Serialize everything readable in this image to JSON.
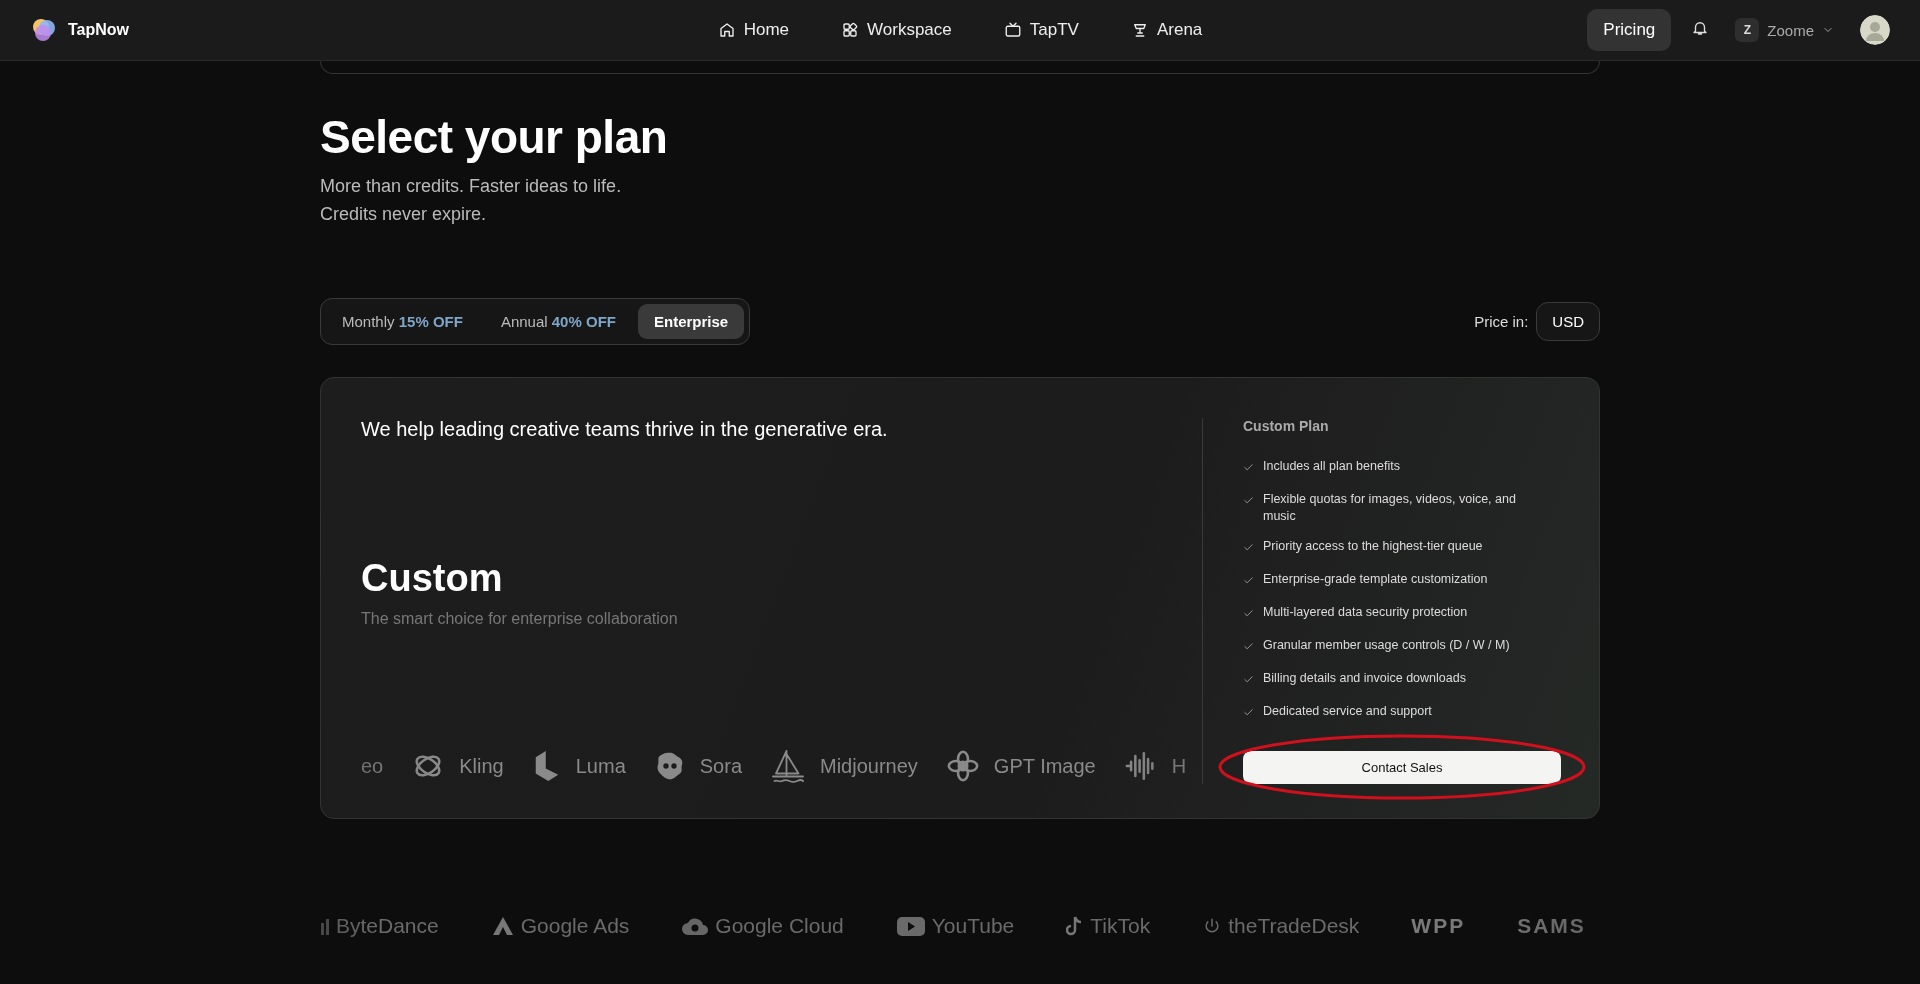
{
  "nav": {
    "brand": "TapNow",
    "links": [
      {
        "label": "Home",
        "selected": false
      },
      {
        "label": "Workspace",
        "selected": false
      },
      {
        "label": "TapTV",
        "selected": false
      },
      {
        "label": "Arena",
        "selected": false
      }
    ],
    "pricing": {
      "label": "Pricing",
      "selected": true
    },
    "user": {
      "initial": "Z",
      "name": "Zoome"
    }
  },
  "hero": {
    "title": "Select your plan",
    "lines": [
      "More than credits. Faster ideas to life.",
      "Credits never expire."
    ]
  },
  "billing_tabs": [
    {
      "label": "Monthly",
      "discount": "15% OFF",
      "selected": false
    },
    {
      "label": "Annual",
      "discount": "40% OFF",
      "selected": false
    },
    {
      "label": "Enterprise",
      "selected": true
    }
  ],
  "currency": {
    "label": "Price in:",
    "value": "USD"
  },
  "plan": {
    "tagline": "We help leading creative teams thrive in the generative era.",
    "name": "Custom",
    "description": "The smart choice for enterprise collaboration",
    "models": [
      "eo",
      "Kling",
      "Luma",
      "Sora",
      "Midjourney",
      "GPT Image",
      "H"
    ],
    "details_title": "Custom Plan",
    "features": [
      "Includes all plan benefits",
      "Flexible quotas for images, videos, voice, and music",
      "Priority access to the highest-tier queue",
      "Enterprise-grade template customization",
      "Multi-layered data security protection",
      "Granular member usage controls (D / W / M)",
      "Billing details and invoice downloads",
      "Dedicated service and support"
    ],
    "cta": {
      "label": "Contact Sales",
      "highlighted": true
    }
  },
  "brands": [
    "ByteDance",
    "Google Ads",
    "Google Cloud",
    "YouTube",
    "TikTok",
    "theTradeDesk",
    "WPP",
    "SAMS"
  ]
}
